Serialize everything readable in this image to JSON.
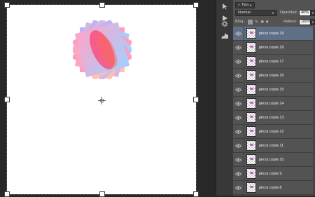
{
  "app": {
    "accent": "#5f6f85"
  },
  "options": {
    "filter_label": "Tipo",
    "blend_mode": "Normal",
    "opacity_label": "Opacidad:",
    "opacity_value": "40%",
    "lock_label": "Bloq.:",
    "fill_label": "Relleno:",
    "fill_value": "100%"
  },
  "layers": [
    {
      "name": "pieza copia 19",
      "selected": true
    },
    {
      "name": "pieza copia 18"
    },
    {
      "name": "pieza copia 17"
    },
    {
      "name": "pieza copia 16"
    },
    {
      "name": "pieza copia 15"
    },
    {
      "name": "pieza copia 14"
    },
    {
      "name": "pieza copia 13"
    },
    {
      "name": "pieza copia 12"
    },
    {
      "name": "pieza copia 11"
    },
    {
      "name": "pieza copia 10"
    },
    {
      "name": "pieza copia 9"
    },
    {
      "name": "pieza copia 8"
    }
  ],
  "tools": [
    "arrow-icon",
    "play-icon",
    "gear-icon",
    "histogram-icon"
  ]
}
